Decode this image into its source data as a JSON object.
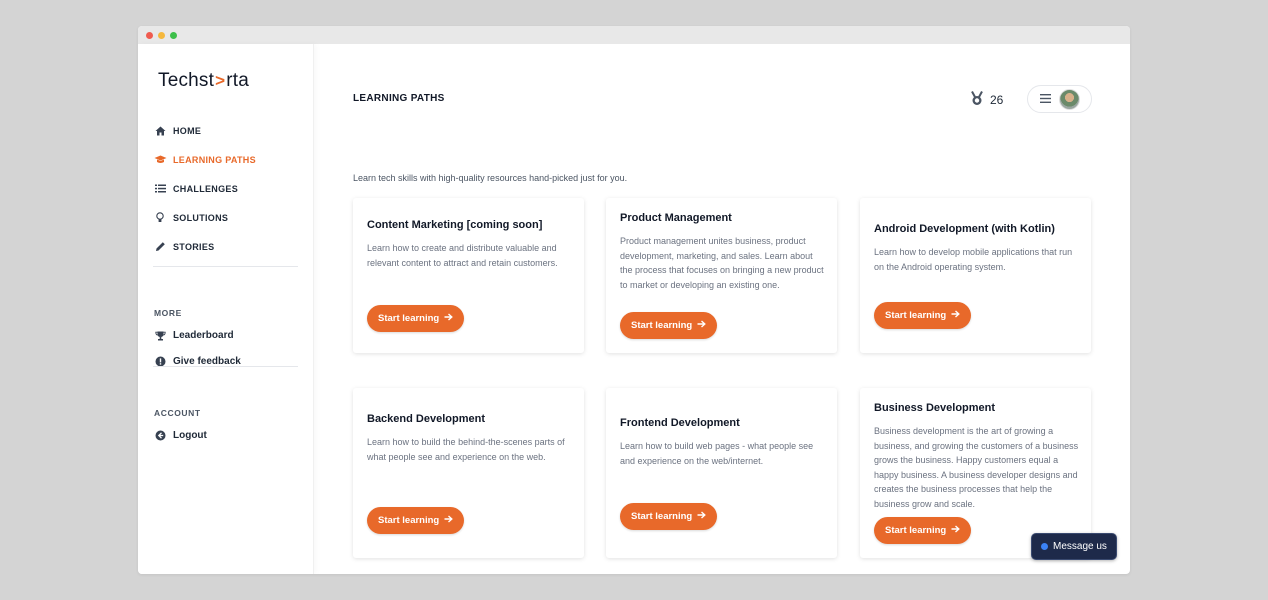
{
  "app": {
    "logo_left": "Techst",
    "logo_arrow": ">",
    "logo_right": "rta"
  },
  "colors": {
    "accent": "#e8692a",
    "message_bg": "#1e2a4a",
    "window_close": "#ef5b4f",
    "window_min": "#f5b83d",
    "window_max": "#3dbf4a"
  },
  "sidebar": {
    "nav": [
      {
        "label": "HOME",
        "icon": "home-icon",
        "active": false
      },
      {
        "label": "LEARNING PATHS",
        "icon": "graduation-cap-icon",
        "active": true
      },
      {
        "label": "CHALLENGES",
        "icon": "list-icon",
        "active": false
      },
      {
        "label": "SOLUTIONS",
        "icon": "lightbulb-icon",
        "active": false
      },
      {
        "label": "STORIES",
        "icon": "pencil-icon",
        "active": false
      }
    ],
    "more_label": "MORE",
    "more": [
      {
        "label": "Leaderboard",
        "icon": "trophy-icon"
      },
      {
        "label": "Give feedback",
        "icon": "alert-circle-icon"
      }
    ],
    "account_label": "ACCOUNT",
    "account": [
      {
        "label": "Logout",
        "icon": "arrow-left-circle-icon"
      }
    ]
  },
  "header": {
    "title": "LEARNING PATHS",
    "points": "26",
    "points_icon": "medal-icon",
    "menu_icon": "hamburger-icon"
  },
  "main": {
    "subtitle": "Learn tech skills with high-quality resources hand-picked just for you.",
    "cards": [
      {
        "title": "Content Marketing [coming soon]",
        "description": "Learn how to create and distribute valuable and relevant content to attract and retain customers.",
        "button": "Start learning"
      },
      {
        "title": "Product Management",
        "description": "Product management unites business, product development, marketing, and sales. Learn about the process that focuses on bringing a new product to market or developing an existing one.",
        "button": "Start learning"
      },
      {
        "title": "Android Development (with Kotlin)",
        "description": "Learn how to develop mobile applications that run on the Android operating system.",
        "button": "Start learning"
      },
      {
        "title": "Backend Development",
        "description": "Learn how to build the behind-the-scenes parts of what people see and experience on the web.",
        "button": "Start learning"
      },
      {
        "title": "Frontend Development",
        "description": "Learn how to build web pages - what people see and experience on the web/internet.",
        "button": "Start learning"
      },
      {
        "title": "Business Development",
        "description": "Business development is the art of growing a business, and growing the customers of a business grows the business. Happy customers equal a happy business. A business developer designs and creates the business processes that help the business grow and scale.",
        "button": "Start learning"
      }
    ]
  },
  "chat": {
    "label": "Message us"
  }
}
